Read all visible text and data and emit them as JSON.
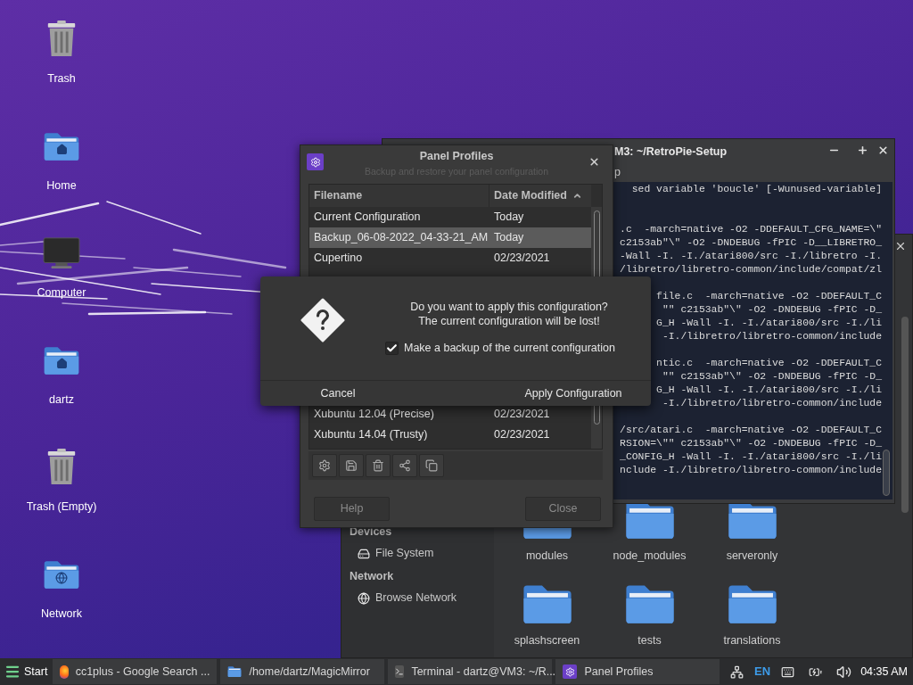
{
  "desktop_icons": [
    {
      "label": "Trash",
      "kind": "trash"
    },
    {
      "label": "Home",
      "kind": "home"
    },
    {
      "label": "Computer",
      "kind": "computer"
    },
    {
      "label": "dartz",
      "kind": "home"
    },
    {
      "label": "Trash (Empty)",
      "kind": "trash"
    },
    {
      "label": "Network",
      "kind": "network"
    }
  ],
  "file_manager": {
    "sidebar": [
      {
        "kind": "header",
        "label": "Devices"
      },
      {
        "kind": "drive",
        "label": "File System"
      },
      {
        "kind": "header",
        "label": "Network"
      },
      {
        "kind": "network",
        "label": "Browse Network"
      }
    ],
    "folders": [
      "modules",
      "node_modules",
      "serveronly",
      "splashscreen",
      "tests",
      "translations"
    ]
  },
  "terminal": {
    "title": "M3: ~/RetroPie-Setup",
    "menu": "p",
    "blocks": [
      [
        "sed variable 'boucle' [-Wunused-variable]"
      ],
      [
        ".c  -march=native -O2 -DDEFAULT_CFG_NAME=\\\"",
        "c2153ab\"\\\" -O2 -DNDEBUG -fPIC -D__LIBRETRO_",
        "-Wall -I. -I./atari800/src -I./libretro -I.",
        "/libretro/libretro-common/include/compat/zl"
      ],
      [
        "file.c  -march=native -O2 -DDEFAULT_C",
        "\"\" c2153ab\"\\\" -O2 -DNDEBUG -fPIC -D_",
        "G_H -Wall -I. -I./atari800/src -I./li",
        "-I./libretro/libretro-common/include"
      ],
      [
        "ntic.c  -march=native -O2 -DDEFAULT_C",
        "\"\" c2153ab\"\\\" -O2 -DNDEBUG -fPIC -D_",
        "G_H -Wall -I. -I./atari800/src -I./li",
        "-I./libretro/libretro-common/include"
      ],
      [
        "/src/atari.c  -march=native -O2 -DDEFAULT_C",
        "RSION=\\\"\" c2153ab\"\\\" -O2 -DNDEBUG -fPIC -D_",
        "_CONFIG_H -Wall -I. -I./atari800/src -I./li",
        "nclude -I./libretro/libretro-common/include"
      ]
    ]
  },
  "panel_profiles": {
    "title": "Panel Profiles",
    "subtitle": "Backup and restore your panel configuration",
    "columns": [
      {
        "label": "Filename",
        "sorted": false
      },
      {
        "label": "Date Modified",
        "sorted": true
      }
    ],
    "rows": [
      {
        "name": "Current Configuration",
        "date": "Today",
        "selected": false
      },
      {
        "name": "Backup_06-08-2022_04-33-21_AM",
        "date": "Today",
        "selected": true
      },
      {
        "name": "Cupertino",
        "date": "02/23/2021",
        "selected": false
      },
      {
        "name": "Xubuntu 12.04 (Precise)",
        "date": "02/23/2021",
        "selected": false
      },
      {
        "name": "Xubuntu 14.04 (Trusty)",
        "date": "02/23/2021",
        "selected": false
      }
    ],
    "buttons": [
      "Help",
      "Close"
    ]
  },
  "confirm_dialog": {
    "message": [
      "Do you want to apply this configuration?",
      "The current configuration will be lost!"
    ],
    "backup_checkbox": {
      "label": "Make a backup of the current configuration",
      "checked": true
    },
    "buttons": [
      "Cancel",
      "Apply Configuration"
    ]
  },
  "taskbar": {
    "start": "Start",
    "tasks": [
      {
        "label": "cc1plus - Google Search ...",
        "kind": "browser"
      },
      {
        "label": "/home/dartz/MagicMirror",
        "kind": "folder"
      },
      {
        "label": "Terminal - dartz@VM3: ~/R...",
        "kind": "terminal"
      },
      {
        "label": "Panel Profiles",
        "kind": "settings"
      }
    ],
    "language": "EN",
    "clock": "04:35 AM"
  }
}
